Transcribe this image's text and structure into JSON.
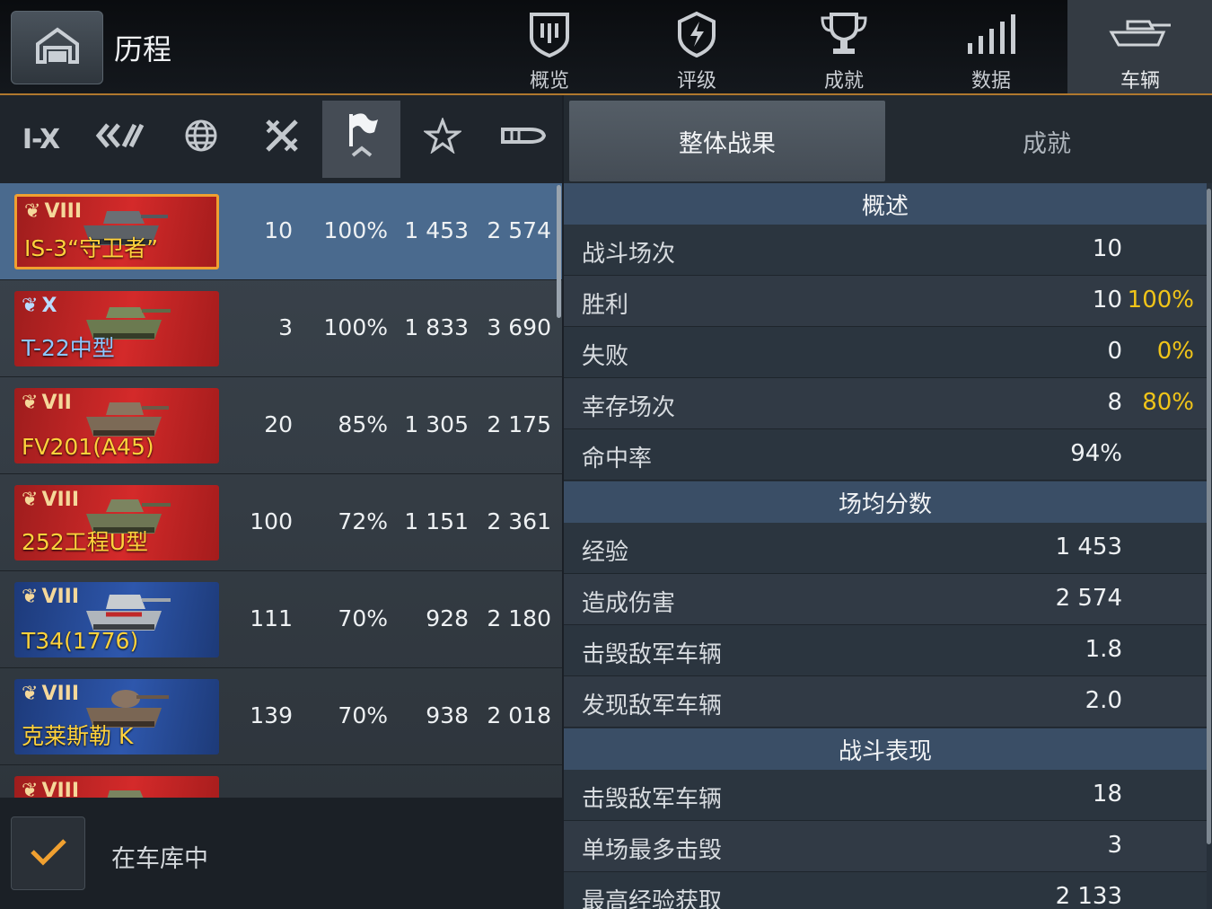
{
  "header": {
    "title": "历程",
    "tabs": [
      {
        "label": "概览",
        "icon": "shield-badge-icon"
      },
      {
        "label": "评级",
        "icon": "rating-shield-icon"
      },
      {
        "label": "成就",
        "icon": "trophy-icon"
      },
      {
        "label": "数据",
        "icon": "bar-signal-icon"
      },
      {
        "label": "车辆",
        "icon": "tank-icon",
        "active": true
      }
    ]
  },
  "filters": {
    "tier_label": "I-X",
    "items": [
      "tier-filter",
      "vehicle-class-filter",
      "nation-filter",
      "battle-type-filter",
      "sort-flag-filter",
      "favorite-star-filter",
      "ammo-filter"
    ],
    "active": "sort-flag-filter"
  },
  "vehicles": [
    {
      "tier": "VIII",
      "name": "IS-3“守卫者”",
      "card": "red",
      "battles": "10",
      "winrate": "100%",
      "avg_xp": "1 453",
      "avg_dmg": "2 574",
      "selected": true
    },
    {
      "tier": "X",
      "name": "T-22中型",
      "card": "red",
      "battles": "3",
      "winrate": "100%",
      "avg_xp": "1 833",
      "avg_dmg": "3 690"
    },
    {
      "tier": "VII",
      "name": "FV201(A45)",
      "card": "red",
      "battles": "20",
      "winrate": "85%",
      "avg_xp": "1 305",
      "avg_dmg": "2 175"
    },
    {
      "tier": "VIII",
      "name": "252工程U型",
      "card": "red",
      "battles": "100",
      "winrate": "72%",
      "avg_xp": "1 151",
      "avg_dmg": "2 361"
    },
    {
      "tier": "VIII",
      "name": "T34(1776)",
      "card": "blue",
      "battles": "111",
      "winrate": "70%",
      "avg_xp": "928",
      "avg_dmg": "2 180"
    },
    {
      "tier": "VIII",
      "name": "克莱斯勒 K",
      "card": "blue",
      "battles": "139",
      "winrate": "70%",
      "avg_xp": "938",
      "avg_dmg": "2 018"
    },
    {
      "tier": "VIII",
      "name": "",
      "card": "red",
      "battles": "",
      "winrate": "",
      "avg_xp": "",
      "avg_dmg": ""
    }
  ],
  "garage_filter": {
    "label": "在车库中",
    "checked": true
  },
  "subtabs": {
    "overall": "整体战果",
    "achievements": "成就"
  },
  "stats": {
    "overview_title": "概述",
    "overview": [
      {
        "label": "战斗场次",
        "value": "10",
        "pct": ""
      },
      {
        "label": "胜利",
        "value": "10",
        "pct": "100%"
      },
      {
        "label": "失败",
        "value": "0",
        "pct": "0%"
      },
      {
        "label": "幸存场次",
        "value": "8",
        "pct": "80%"
      },
      {
        "label": "命中率",
        "value": "94%",
        "pct": ""
      }
    ],
    "avg_title": "场均分数",
    "averages": [
      {
        "label": "经验",
        "value": "1 453"
      },
      {
        "label": "造成伤害",
        "value": "2 574"
      },
      {
        "label": "击毁敌军车辆",
        "value": "1.8"
      },
      {
        "label": "发现敌军车辆",
        "value": "2.0"
      }
    ],
    "perf_title": "战斗表现",
    "performance": [
      {
        "label": "击毁敌军车辆",
        "value": "18"
      },
      {
        "label": "单场最多击毁",
        "value": "3"
      },
      {
        "label": "最高经验获取",
        "value": "2 133"
      }
    ]
  },
  "colors": {
    "accent": "#f0c419",
    "selected_row": "#4a6a8e",
    "section_header": "#3a4e66",
    "checkmark": "#f0a030"
  }
}
